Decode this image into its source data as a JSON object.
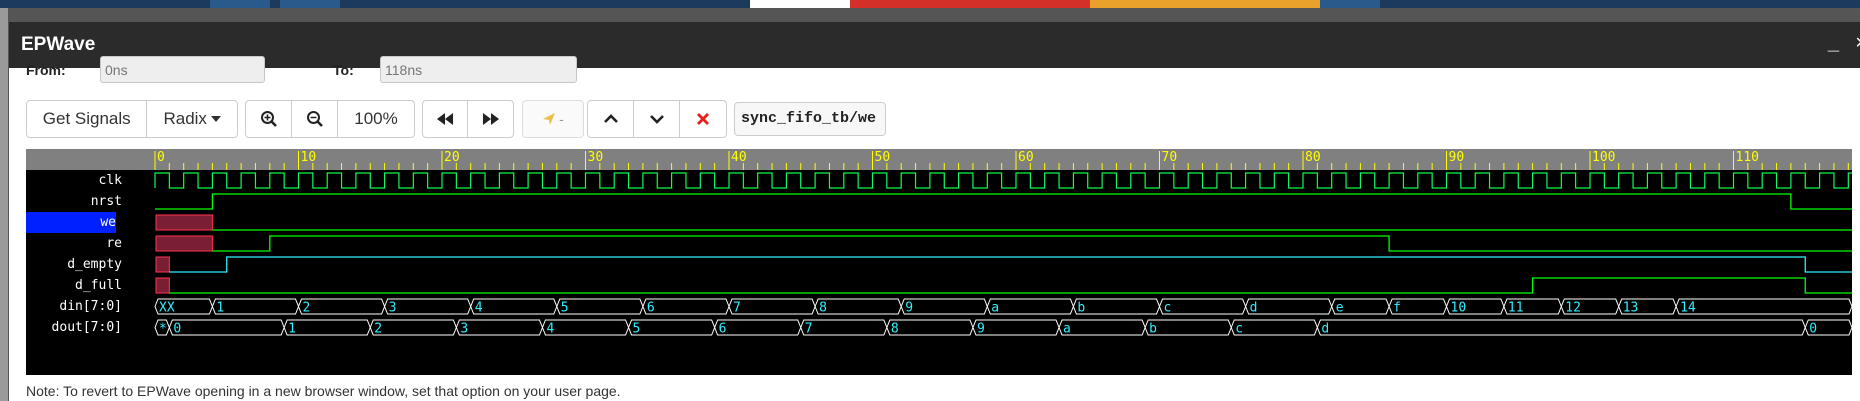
{
  "window": {
    "title": "EPWave",
    "minimize_label": "_",
    "close_label": "×"
  },
  "range": {
    "from_label": "From:",
    "from_value": "0ns",
    "to_label": "To:",
    "to_value": "118ns"
  },
  "toolbar": {
    "get_signals": "Get Signals",
    "radix": "Radix",
    "zoom_level": "100%",
    "cursor_label": "-",
    "signal_path": "sync_fifo_tb/we"
  },
  "ruler": {
    "ticks": [
      "0",
      "10",
      "20",
      "30",
      "40",
      "50",
      "60",
      "70",
      "80",
      "90",
      "100",
      "110"
    ]
  },
  "signals": [
    {
      "name": "clk",
      "selected": false
    },
    {
      "name": "nrst",
      "selected": false
    },
    {
      "name": "we",
      "selected": true
    },
    {
      "name": "re",
      "selected": false
    },
    {
      "name": "d_empty",
      "selected": false
    },
    {
      "name": "d_full",
      "selected": false
    },
    {
      "name": "din[7:0]",
      "selected": false
    },
    {
      "name": "dout[7:0]",
      "selected": false
    }
  ],
  "waves": {
    "nrst": {
      "transitions": [
        [
          0,
          0
        ],
        [
          4,
          1
        ],
        [
          114,
          0
        ]
      ]
    },
    "we": {
      "unknown_until": 4,
      "transitions": [
        [
          4,
          0
        ]
      ]
    },
    "re": {
      "unknown_until": 4,
      "transitions": [
        [
          4,
          0
        ],
        [
          8,
          1
        ],
        [
          86,
          0
        ]
      ]
    },
    "d_empty": {
      "unknown_until": 1,
      "transitions": [
        [
          1,
          0
        ],
        [
          5,
          1
        ],
        [
          115,
          0
        ]
      ]
    },
    "d_full": {
      "unknown_until": 1,
      "transitions": [
        [
          1,
          0
        ],
        [
          96,
          1
        ],
        [
          115,
          0
        ]
      ]
    },
    "din": [
      [
        "0",
        "XX"
      ],
      [
        "4",
        "1"
      ],
      [
        "10",
        "2"
      ],
      [
        "16",
        "3"
      ],
      [
        "22",
        "4"
      ],
      [
        "28",
        "5"
      ],
      [
        "34",
        "6"
      ],
      [
        "40",
        "7"
      ],
      [
        "46",
        "8"
      ],
      [
        "52",
        "9"
      ],
      [
        "58",
        "a"
      ],
      [
        "64",
        "b"
      ],
      [
        "70",
        "c"
      ],
      [
        "76",
        "d"
      ],
      [
        "82",
        "e"
      ],
      [
        "86",
        "f"
      ],
      [
        "90",
        "10"
      ],
      [
        "94",
        "11"
      ],
      [
        "98",
        "12"
      ],
      [
        "102",
        "13"
      ],
      [
        "106",
        "14"
      ]
    ],
    "dout": [
      [
        "0",
        "*"
      ],
      [
        "1",
        "0"
      ],
      [
        "9",
        "1"
      ],
      [
        "15",
        "2"
      ],
      [
        "21",
        "3"
      ],
      [
        "27",
        "4"
      ],
      [
        "33",
        "5"
      ],
      [
        "39",
        "6"
      ],
      [
        "45",
        "7"
      ],
      [
        "51",
        "8"
      ],
      [
        "57",
        "9"
      ],
      [
        "63",
        "a"
      ],
      [
        "69",
        "b"
      ],
      [
        "75",
        "c"
      ],
      [
        "81",
        "d"
      ],
      [
        "115",
        "0"
      ]
    ]
  },
  "note": "Note: To revert to EPWave opening in a new browser window, set that option on your user page."
}
